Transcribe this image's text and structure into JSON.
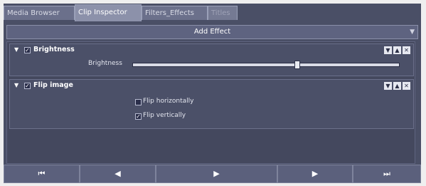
{
  "tabs": [
    {
      "label": "Media Browser"
    },
    {
      "label": "Clip Inspector"
    },
    {
      "label": "Filters_Effects"
    },
    {
      "label": "Titles"
    }
  ],
  "add_effect": {
    "label": "Add Effect",
    "arrow": "▼"
  },
  "effects": [
    {
      "title": "Brightness",
      "enabled": true,
      "params": [
        {
          "label": "Brightness",
          "value": 0.62
        }
      ]
    },
    {
      "title": "Flip image",
      "enabled": true,
      "options": [
        {
          "label": "Flip horizontally",
          "checked": false
        },
        {
          "label": "Flip vertically",
          "checked": true
        }
      ]
    }
  ],
  "icons": {
    "collapse": "▼",
    "move_down": "▼",
    "move_up": "▲",
    "remove": "✕",
    "check": "✓",
    "skip_back": "⏮",
    "step_back": "◀",
    "play": "▶",
    "step_forward": "▶",
    "skip_forward": "⏭"
  },
  "colors": {
    "panel": "#4a4f66",
    "accent": "#8c91aa"
  }
}
